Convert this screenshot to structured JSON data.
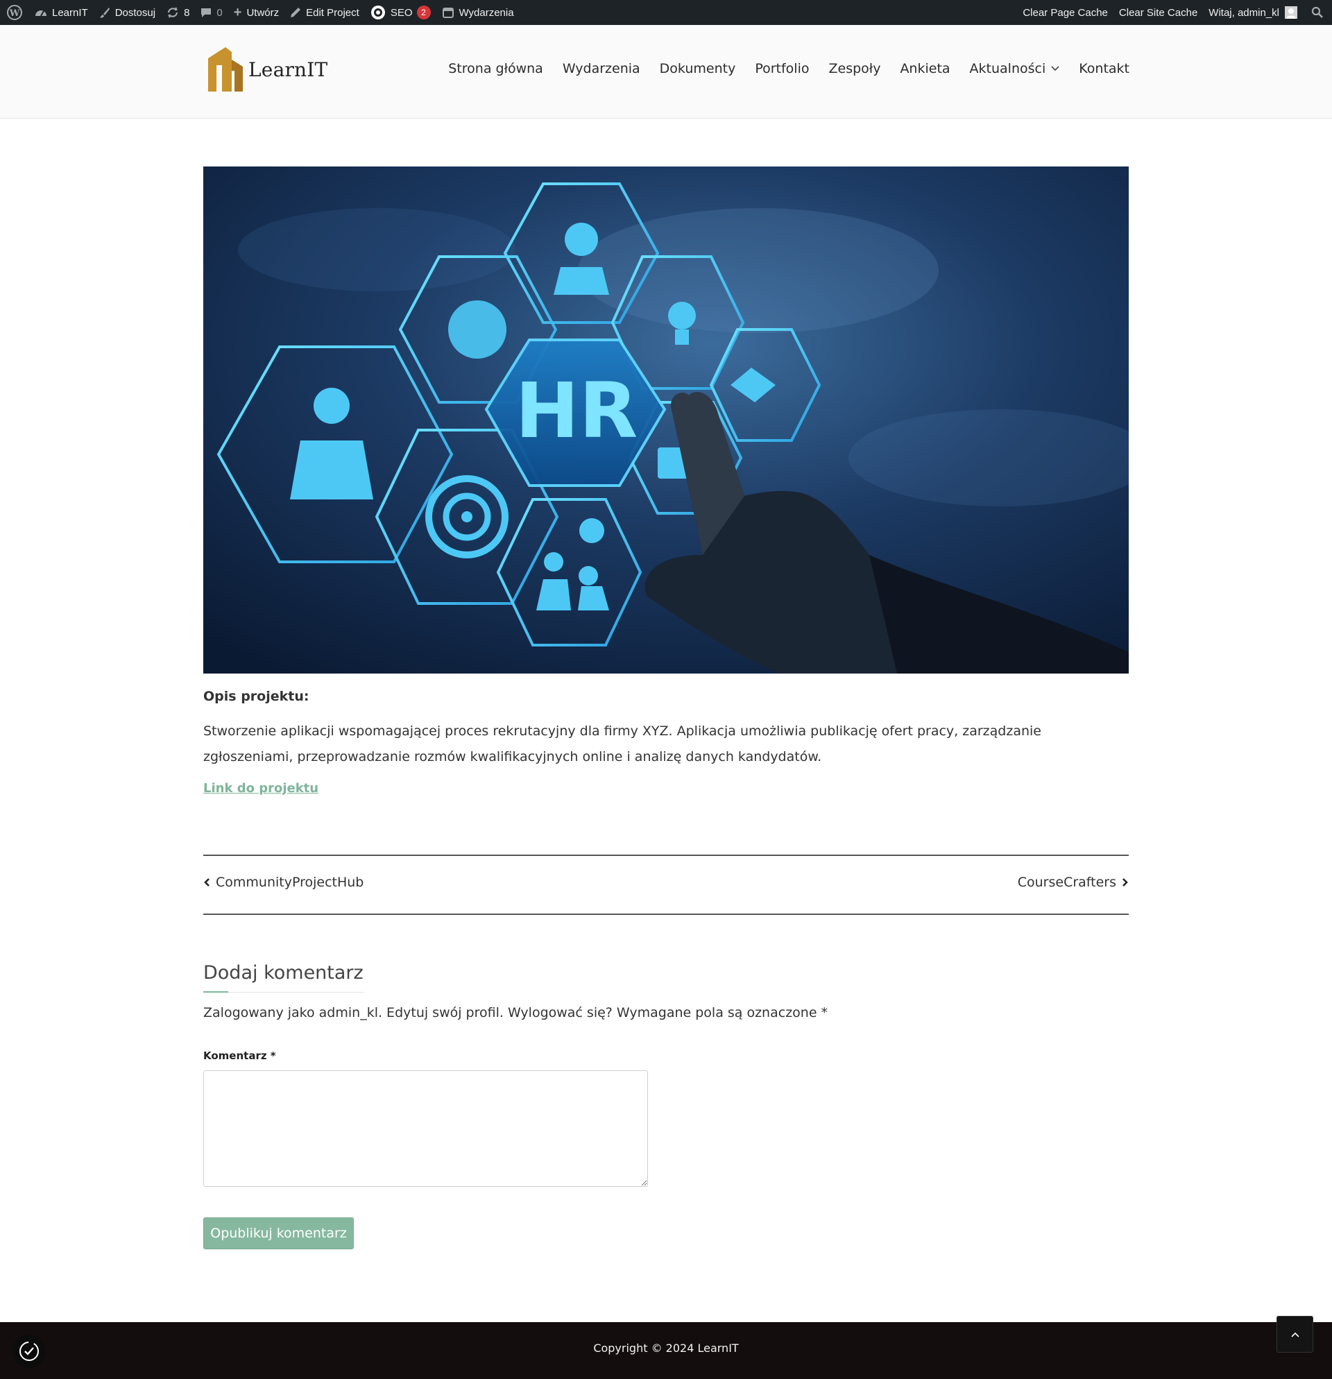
{
  "admin_bar": {
    "site_name": "LearnIT",
    "customize": "Dostosuj",
    "updates_count": "8",
    "comments_count": "0",
    "new_label": "Utwórz",
    "edit_label": "Edit Project",
    "seo_label": "SEO",
    "seo_badge": "2",
    "events_label": "Wydarzenia",
    "clear_page_cache": "Clear Page Cache",
    "clear_site_cache": "Clear Site Cache",
    "greeting": "Witaj, admin_kl"
  },
  "header": {
    "logo_text": "LearnIT",
    "nav": [
      {
        "label": "Strona główna"
      },
      {
        "label": "Wydarzenia"
      },
      {
        "label": "Dokumenty"
      },
      {
        "label": "Portfolio"
      },
      {
        "label": "Zespoły"
      },
      {
        "label": "Ankieta"
      },
      {
        "label": "Aktualności"
      },
      {
        "label": "Kontakt"
      }
    ]
  },
  "featured_image": {
    "center_text": "HR"
  },
  "project": {
    "desc_title": "Opis projektu:",
    "desc_text": "Stworzenie aplikacji wspomagającej proces rekrutacyjny dla firmy XYZ. Aplikacja umożliwia publikację ofert pracy, zarządzanie zgłoszeniami, przeprowadzanie rozmów kwalifikacyjnych online i analizę danych kandydatów.",
    "link_text": "Link do projektu"
  },
  "post_nav": {
    "prev_title": "CommunityProjectHub",
    "next_title": "CourseCrafters"
  },
  "comments": {
    "reply_title": "Dodaj komentarz",
    "logged_in_text": "Zalogowany jako admin_kl. Edytuj swój profil. Wylogować się? Wymagane pola są oznaczone *",
    "comment_label": "Komentarz *",
    "submit_label": "Opublikuj komentarz"
  },
  "footer": {
    "copyright": "Copyright © 2024 LearnIT"
  },
  "colors": {
    "accent": "#86b89f",
    "admin_bar": "#1d2327",
    "footer": "#140d0d",
    "logo": "#c8922e"
  }
}
